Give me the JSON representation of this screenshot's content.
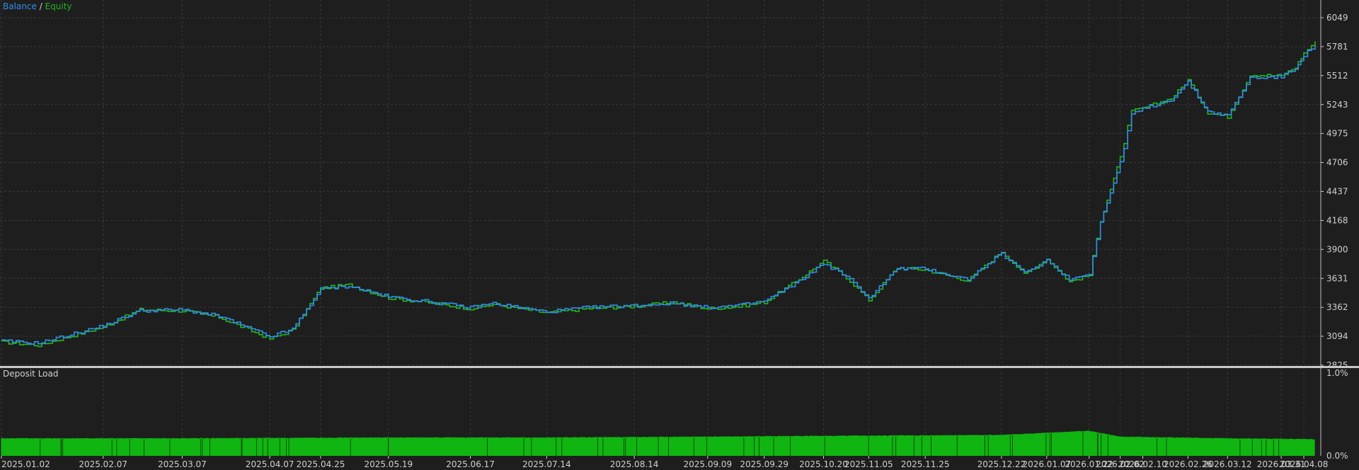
{
  "chart_data": [
    {
      "type": "line",
      "title": "",
      "legend": [
        {
          "name": "Balance",
          "color": "#2f8fe8"
        },
        {
          "name": "Equity",
          "color": "#22b522"
        }
      ],
      "legend_separator": "/",
      "ylim": [
        2825,
        6049
      ],
      "yticks": [
        "6049",
        "5781",
        "5512",
        "5243",
        "4975",
        "4706",
        "4437",
        "4168",
        "3900",
        "3631",
        "3362",
        "3094",
        "2825"
      ],
      "grid": true,
      "series": [
        {
          "name": "Balance",
          "color": "#2f8fe8",
          "x": [
            "2025.01.02",
            "2025.01.15",
            "2025.02.07",
            "2025.02.20",
            "2025.03.07",
            "2025.03.20",
            "2025.04.07",
            "2025.04.15",
            "2025.04.25",
            "2025.05.05",
            "2025.05.19",
            "2025.06.01",
            "2025.06.17",
            "2025.06.25",
            "2025.07.14",
            "2025.07.28",
            "2025.08.14",
            "2025.08.28",
            "2025.09.09",
            "2025.09.20",
            "2025.09.29",
            "2025.10.10",
            "2025.10.20",
            "2025.10.28",
            "2025.11.05",
            "2025.11.15",
            "2025.11.25",
            "2025.12.10",
            "2025.12.22",
            "2025.12.30",
            "2026.01.07",
            "2026.01.15",
            "2026.01.22",
            "2026.01.26",
            "2026.02.02",
            "2026.02.06",
            "2026.02.10",
            "2026.02.20",
            "2026.02.26",
            "2026.03.05",
            "2026.03.12",
            "2026.03.20",
            "2026.03.31",
            "2026.04.05",
            "2026.04.08",
            "2026.04.12"
          ],
          "y": [
            3050,
            3030,
            3190,
            3330,
            3340,
            3280,
            3090,
            3160,
            3530,
            3560,
            3460,
            3420,
            3360,
            3400,
            3320,
            3360,
            3380,
            3400,
            3360,
            3380,
            3420,
            3580,
            3770,
            3650,
            3450,
            3720,
            3720,
            3620,
            3860,
            3680,
            3800,
            3620,
            3680,
            4150,
            4700,
            5150,
            5200,
            5290,
            5450,
            5180,
            5140,
            5490,
            5500,
            5580,
            5700,
            5790
          ]
        },
        {
          "name": "Equity",
          "color": "#22b522",
          "x": [
            "2025.01.02",
            "2025.01.15",
            "2025.02.07",
            "2025.02.20",
            "2025.03.07",
            "2025.03.20",
            "2025.04.07",
            "2025.04.15",
            "2025.04.25",
            "2025.05.05",
            "2025.05.19",
            "2025.06.01",
            "2025.06.17",
            "2025.06.25",
            "2025.07.14",
            "2025.07.28",
            "2025.08.14",
            "2025.08.28",
            "2025.09.09",
            "2025.09.20",
            "2025.09.29",
            "2025.10.10",
            "2025.10.20",
            "2025.10.28",
            "2025.11.05",
            "2025.11.15",
            "2025.11.25",
            "2025.12.10",
            "2025.12.22",
            "2025.12.30",
            "2026.01.07",
            "2026.01.15",
            "2026.01.22",
            "2026.01.26",
            "2026.02.02",
            "2026.02.06",
            "2026.02.10",
            "2026.02.20",
            "2026.02.26",
            "2026.03.05",
            "2026.03.12",
            "2026.03.20",
            "2026.03.31",
            "2026.04.05",
            "2026.04.08",
            "2026.04.12"
          ],
          "y": [
            3040,
            3010,
            3180,
            3340,
            3330,
            3270,
            3070,
            3150,
            3540,
            3570,
            3450,
            3410,
            3350,
            3390,
            3310,
            3350,
            3370,
            3410,
            3350,
            3370,
            3410,
            3600,
            3790,
            3640,
            3430,
            3730,
            3710,
            3610,
            3880,
            3670,
            3810,
            3600,
            3660,
            4170,
            4750,
            5180,
            5210,
            5300,
            5470,
            5170,
            5130,
            5520,
            5510,
            5590,
            5720,
            5830
          ]
        }
      ]
    },
    {
      "type": "area",
      "title": "Deposit Load",
      "ylim": [
        0,
        1.0
      ],
      "yticks": [
        "1.0%",
        "0.0%"
      ],
      "series": [
        {
          "name": "Deposit Load",
          "color": "#11b511",
          "x": [
            "2025.01.02",
            "2025.03.07",
            "2025.05.19",
            "2025.07.14",
            "2025.09.09",
            "2025.10.20",
            "2025.12.22",
            "2026.01.22",
            "2026.02.02",
            "2026.03.12",
            "2026.04.12"
          ],
          "y": [
            0.21,
            0.21,
            0.22,
            0.22,
            0.23,
            0.24,
            0.25,
            0.3,
            0.23,
            0.21,
            0.2
          ]
        }
      ]
    }
  ],
  "x_ticks": [
    "2025.01.02",
    "2025.02.07",
    "2025.03.07",
    "2025.04.07",
    "2025.04.25",
    "2025.05.19",
    "2025.06.17",
    "2025.07.14",
    "2025.08.14",
    "2025.09.09",
    "2025.09.29",
    "2025.10.20",
    "2025.11.05",
    "2025.11.25",
    "2025.12.22",
    "2026.01.07",
    "2026.01.22",
    "2026.02.02",
    "2026.02.10",
    "2026.02.26",
    "2026.03.12",
    "2026.03.31",
    "2026.04.08"
  ],
  "colors": {
    "background": "#1e1e1e",
    "grid": "#3a3a3a",
    "axis_text": "#d0d0d0",
    "separator": "#c8c8c8"
  }
}
